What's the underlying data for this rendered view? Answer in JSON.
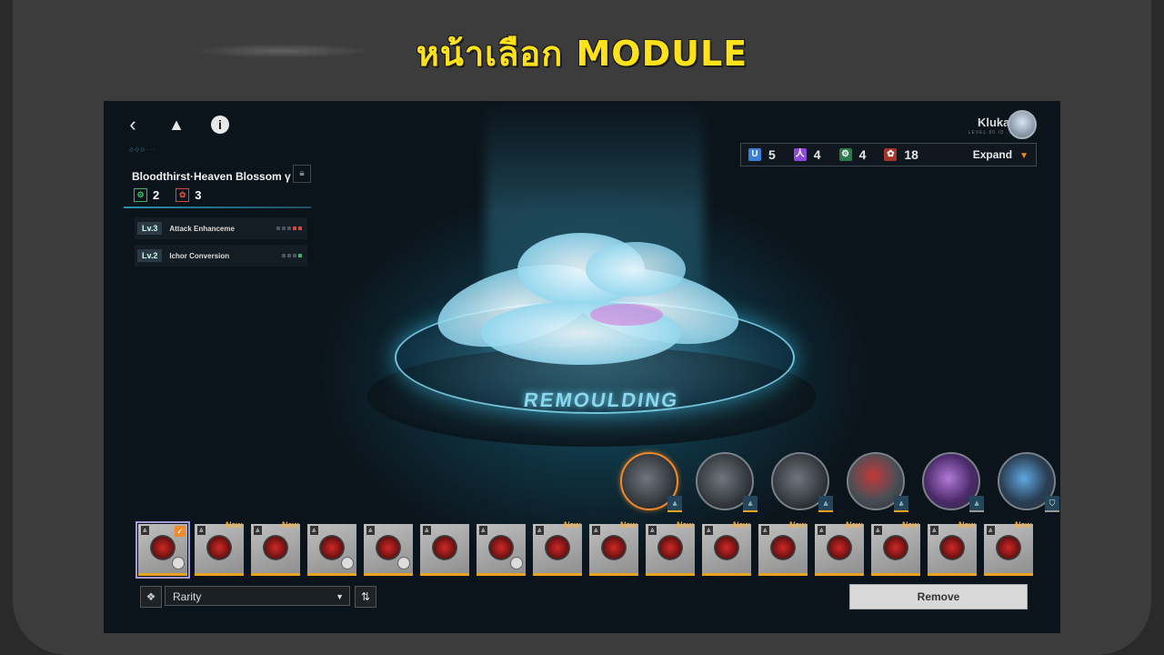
{
  "banner": {
    "title": "หน้าเลือก MODULE"
  },
  "topbar": {
    "back_icon": "chevron-left-icon",
    "home_icon": "triangle-logo-icon",
    "info_icon": "info-icon",
    "username": "Klukai",
    "user_subtitle": "LEVEL 80 ID ..."
  },
  "counts": {
    "items": [
      {
        "icon": "blue-shield-icon",
        "value": "5",
        "color": "#3a7fd8"
      },
      {
        "icon": "purple-tower-icon",
        "value": "4",
        "color": "#8b4bd8"
      },
      {
        "icon": "green-gear-icon",
        "value": "4",
        "color": "#3fb56b"
      },
      {
        "icon": "red-blossom-icon",
        "value": "18",
        "color": "#d14a3a"
      }
    ],
    "expand_label": "Expand"
  },
  "module": {
    "name": "Bloodthirst·Heaven Blossom γ",
    "stat_green": "2",
    "stat_red": "3",
    "effects": [
      {
        "level": "Lv.3",
        "name": "Attack Enhanceme"
      },
      {
        "level": "Lv.2",
        "name": "Ichor Conversion"
      }
    ]
  },
  "stage": {
    "label": "REMOULDING"
  },
  "slots": [
    {
      "name": "blossom-module",
      "selected": true
    },
    {
      "name": "fan-blade-module"
    },
    {
      "name": "fan-blade-module"
    },
    {
      "name": "red-blossom-module"
    },
    {
      "name": "purple-crystal-module"
    },
    {
      "name": "blue-claw-module"
    }
  ],
  "inventory": [
    {
      "new": "",
      "checked": true
    },
    {
      "new": "New"
    },
    {
      "new": "New"
    },
    {
      "new": ""
    },
    {
      "new": ""
    },
    {
      "new": ""
    },
    {
      "new": ""
    },
    {
      "new": "New"
    },
    {
      "new": "New"
    },
    {
      "new": "New"
    },
    {
      "new": "New"
    },
    {
      "new": "New"
    },
    {
      "new": "New"
    },
    {
      "new": "New"
    },
    {
      "new": "New"
    },
    {
      "new": "New"
    }
  ],
  "controls": {
    "sort_value": "Rarity",
    "remove_label": "Remove"
  }
}
